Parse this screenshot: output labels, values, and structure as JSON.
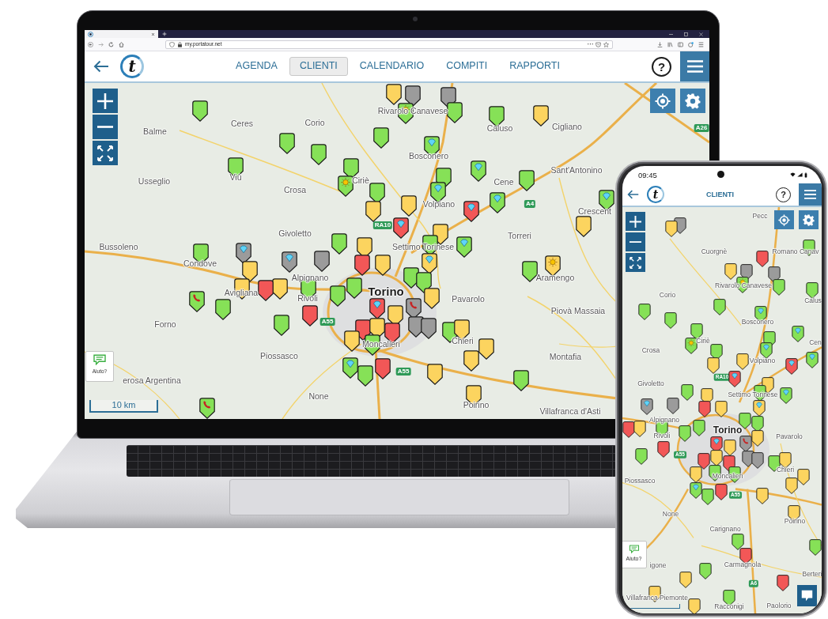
{
  "laptop": {
    "browser": {
      "url": "my.portatour.net"
    },
    "app": {
      "logo_letter": "t",
      "tabs": [
        {
          "label": "AGENDA",
          "selected": false
        },
        {
          "label": "CLIENTI",
          "selected": true
        },
        {
          "label": "CALENDARIO",
          "selected": false
        },
        {
          "label": "COMPITI",
          "selected": false
        },
        {
          "label": "RAPPORTI",
          "selected": false
        }
      ],
      "help": "?"
    },
    "map": {
      "places": [
        {
          "name": "Rivarolo Canavese",
          "kind": "town"
        },
        {
          "name": "Balme",
          "kind": "town"
        },
        {
          "name": "Ceres",
          "kind": "town"
        },
        {
          "name": "Corio",
          "kind": "town"
        },
        {
          "name": "Caluso",
          "kind": "town"
        },
        {
          "name": "Cigliano",
          "kind": "town"
        },
        {
          "name": "Bosconero",
          "kind": "town"
        },
        {
          "name": "Usseglio",
          "kind": "town"
        },
        {
          "name": "Viù",
          "kind": "town"
        },
        {
          "name": "Crosa",
          "kind": "town"
        },
        {
          "name": "Ciriè",
          "kind": "town"
        },
        {
          "name": "Cene",
          "kind": "town"
        },
        {
          "name": "Sant'Antonino",
          "kind": "town"
        },
        {
          "name": "Volpiano",
          "kind": "town"
        },
        {
          "name": "Crescent",
          "kind": "town"
        },
        {
          "name": "Givoletto",
          "kind": "town"
        },
        {
          "name": "Torreri",
          "kind": "town"
        },
        {
          "name": "Bussoleno",
          "kind": "town"
        },
        {
          "name": "Settimo Torinese",
          "kind": "town"
        },
        {
          "name": "Condove",
          "kind": "town"
        },
        {
          "name": "Alpignano",
          "kind": "town"
        },
        {
          "name": "Aramengo",
          "kind": "town"
        },
        {
          "name": "Avigliana",
          "kind": "town"
        },
        {
          "name": "Rivoli",
          "kind": "town"
        },
        {
          "name": "Torino",
          "kind": "city"
        },
        {
          "name": "Pavarolo",
          "kind": "town"
        },
        {
          "name": "Piovà Massaia",
          "kind": "town"
        },
        {
          "name": "Forno",
          "kind": "town"
        },
        {
          "name": "Moncalieri",
          "kind": "town"
        },
        {
          "name": "Chieri",
          "kind": "town"
        },
        {
          "name": "Piossasco",
          "kind": "town"
        },
        {
          "name": "Montafia",
          "kind": "town"
        },
        {
          "name": "erosa Argentina",
          "kind": "town"
        },
        {
          "name": "None",
          "kind": "town"
        },
        {
          "name": "Poirino",
          "kind": "town"
        },
        {
          "name": "Villafranca d'Asti",
          "kind": "town"
        }
      ],
      "roads": [
        "A26",
        "A4",
        "RA10",
        "A55",
        "A55"
      ],
      "markers": [
        {
          "kind": "plain",
          "color": "#fcd45f"
        },
        {
          "kind": "plain",
          "color": "#9b9b9b"
        },
        {
          "kind": "plain",
          "color": "#9b9b9b"
        },
        {
          "kind": "sun",
          "color": "#86e157"
        },
        {
          "kind": "plain",
          "color": "#86e157"
        },
        {
          "kind": "plain",
          "color": "#86e157"
        },
        {
          "kind": "plain",
          "color": "#86e157"
        },
        {
          "kind": "plain",
          "color": "#fcd45f"
        },
        {
          "kind": "plain",
          "color": "#86e157"
        },
        {
          "kind": "plain",
          "color": "#86e157"
        },
        {
          "kind": "diamond",
          "color": "#86e157"
        },
        {
          "kind": "plain",
          "color": "#86e157"
        },
        {
          "kind": "plain",
          "color": "#86e157"
        },
        {
          "kind": "plain",
          "color": "#86e157"
        },
        {
          "kind": "diamond",
          "color": "#86e157"
        },
        {
          "kind": "plain",
          "color": "#86e157"
        },
        {
          "kind": "plain",
          "color": "#86e157"
        },
        {
          "kind": "sun",
          "color": "#86e157"
        },
        {
          "kind": "diamond",
          "color": "#86e157"
        },
        {
          "kind": "plain",
          "color": "#86e157"
        },
        {
          "kind": "diamond",
          "color": "#86e157"
        },
        {
          "kind": "diamond",
          "color": "#86e157"
        },
        {
          "kind": "plain",
          "color": "#fcd45f"
        },
        {
          "kind": "plain",
          "color": "#fcd45f"
        },
        {
          "kind": "diamond",
          "color": "#f25757"
        },
        {
          "kind": "plain",
          "color": "#fcd45f"
        },
        {
          "kind": "diamond",
          "color": "#f25757"
        },
        {
          "kind": "plain",
          "color": "#fcd45f"
        },
        {
          "kind": "plain",
          "color": "#86e157"
        },
        {
          "kind": "plain",
          "color": "#86e157"
        },
        {
          "kind": "diamond",
          "color": "#86e157"
        },
        {
          "kind": "plain",
          "color": "#fcd45f"
        },
        {
          "kind": "diamond",
          "color": "#9b9b9b"
        },
        {
          "kind": "plain",
          "color": "#86e157"
        },
        {
          "kind": "diamond",
          "color": "#9b9b9b"
        },
        {
          "kind": "plain",
          "color": "#9b9b9b"
        },
        {
          "kind": "plain",
          "color": "#f25757"
        },
        {
          "kind": "plain",
          "color": "#fcd45f"
        },
        {
          "kind": "diamond",
          "color": "#fcd45f"
        },
        {
          "kind": "sun",
          "color": "#fcd45f"
        },
        {
          "kind": "plain",
          "color": "#86e157"
        },
        {
          "kind": "plain",
          "color": "#fcd45f"
        },
        {
          "kind": "plain",
          "color": "#86e157"
        },
        {
          "kind": "plain",
          "color": "#fcd45f"
        },
        {
          "kind": "plain",
          "color": "#86e157"
        },
        {
          "kind": "plain",
          "color": "#86e157"
        },
        {
          "kind": "plain",
          "color": "#fcd45f"
        },
        {
          "kind": "plain",
          "color": "#86e157"
        },
        {
          "kind": "plain",
          "color": "#f25757"
        },
        {
          "kind": "plain",
          "color": "#fcd45f"
        },
        {
          "kind": "plain",
          "color": "#86e157"
        },
        {
          "kind": "phone",
          "color": "#86e157"
        },
        {
          "kind": "diamond",
          "color": "#f25757"
        },
        {
          "kind": "phone",
          "color": "#9b9b9b"
        },
        {
          "kind": "plain",
          "color": "#86e157"
        },
        {
          "kind": "plain",
          "color": "#f25757"
        },
        {
          "kind": "plain",
          "color": "#fcd45f"
        },
        {
          "kind": "plain",
          "color": "#86e157"
        },
        {
          "kind": "plain",
          "color": "#9b9b9b"
        },
        {
          "kind": "plain",
          "color": "#9b9b9b"
        },
        {
          "kind": "plain",
          "color": "#f25757"
        },
        {
          "kind": "plain",
          "color": "#fcd45f"
        },
        {
          "kind": "plain",
          "color": "#f25757"
        },
        {
          "kind": "plain",
          "color": "#86e157"
        },
        {
          "kind": "plain",
          "color": "#fcd45f"
        },
        {
          "kind": "plain",
          "color": "#fcd45f"
        },
        {
          "kind": "plain",
          "color": "#86e157"
        },
        {
          "kind": "plain",
          "color": "#fcd45f"
        },
        {
          "kind": "plain",
          "color": "#fcd45f"
        },
        {
          "kind": "diamond",
          "color": "#86e157"
        },
        {
          "kind": "plain",
          "color": "#f25757"
        },
        {
          "kind": "plain",
          "color": "#fcd45f"
        },
        {
          "kind": "plain",
          "color": "#86e157"
        },
        {
          "kind": "plain",
          "color": "#86e157"
        },
        {
          "kind": "plain",
          "color": "#fcd45f"
        },
        {
          "kind": "phone",
          "color": "#86e157"
        }
      ],
      "help_label": "Aiuto?",
      "scale": "10 km"
    }
  },
  "phone": {
    "status": {
      "time": "09:45"
    },
    "app": {
      "logo_letter": "t",
      "title": "CLIENTI",
      "help": "?"
    },
    "map": {
      "places": [
        {
          "name": "Pecc",
          "kind": "town"
        },
        {
          "name": "Cuorgnè",
          "kind": "town"
        },
        {
          "name": "Romano Canav",
          "kind": "town"
        },
        {
          "name": "Rivarolo Canavese",
          "kind": "town"
        },
        {
          "name": "Corio",
          "kind": "town"
        },
        {
          "name": "Calus",
          "kind": "town"
        },
        {
          "name": "Bosconero",
          "kind": "town"
        },
        {
          "name": "Crosa",
          "kind": "town"
        },
        {
          "name": "Ciriè",
          "kind": "town"
        },
        {
          "name": "Cen",
          "kind": "town"
        },
        {
          "name": "Volpiano",
          "kind": "town"
        },
        {
          "name": "Givoletto",
          "kind": "town"
        },
        {
          "name": "Settimo Torinese",
          "kind": "town"
        },
        {
          "name": "Alpignano",
          "kind": "town"
        },
        {
          "name": "Rivoli",
          "kind": "town"
        },
        {
          "name": "Torino",
          "kind": "city"
        },
        {
          "name": "Pavarolo",
          "kind": "town"
        },
        {
          "name": "Piossasco",
          "kind": "town"
        },
        {
          "name": "Moncalieri",
          "kind": "town"
        },
        {
          "name": "Chieri",
          "kind": "town"
        },
        {
          "name": "None",
          "kind": "town"
        },
        {
          "name": "Carignano",
          "kind": "town"
        },
        {
          "name": "Poirino",
          "kind": "town"
        },
        {
          "name": "igone",
          "kind": "town"
        },
        {
          "name": "Carmagnola",
          "kind": "town"
        },
        {
          "name": "Berteri",
          "kind": "town"
        },
        {
          "name": "Villafranca Piemonte",
          "kind": "town"
        },
        {
          "name": "Racconigi",
          "kind": "town"
        },
        {
          "name": "Paolorio",
          "kind": "town"
        }
      ],
      "roads": [
        "RA10",
        "A55",
        "A55",
        "A6"
      ],
      "markers": [
        {
          "kind": "plain",
          "color": "#9b9b9b"
        },
        {
          "kind": "plain",
          "color": "#fcd45f"
        },
        {
          "kind": "plain",
          "color": "#86e157"
        },
        {
          "kind": "plain",
          "color": "#f25757"
        },
        {
          "kind": "plain",
          "color": "#fcd45f"
        },
        {
          "kind": "plain",
          "color": "#9b9b9b"
        },
        {
          "kind": "plain",
          "color": "#9b9b9b"
        },
        {
          "kind": "sun",
          "color": "#86e157"
        },
        {
          "kind": "plain",
          "color": "#86e157"
        },
        {
          "kind": "plain",
          "color": "#86e157"
        },
        {
          "kind": "plain",
          "color": "#86e157"
        },
        {
          "kind": "plain",
          "color": "#86e157"
        },
        {
          "kind": "diamond",
          "color": "#86e157"
        },
        {
          "kind": "plain",
          "color": "#86e157"
        },
        {
          "kind": "plain",
          "color": "#86e157"
        },
        {
          "kind": "diamond",
          "color": "#86e157"
        },
        {
          "kind": "plain",
          "color": "#86e157"
        },
        {
          "kind": "sun",
          "color": "#86e157"
        },
        {
          "kind": "diamond",
          "color": "#86e157"
        },
        {
          "kind": "plain",
          "color": "#86e157"
        },
        {
          "kind": "diamond",
          "color": "#86e157"
        },
        {
          "kind": "plain",
          "color": "#fcd45f"
        },
        {
          "kind": "plain",
          "color": "#fcd45f"
        },
        {
          "kind": "diamond",
          "color": "#f25757"
        },
        {
          "kind": "diamond",
          "color": "#f25757"
        },
        {
          "kind": "plain",
          "color": "#fcd45f"
        },
        {
          "kind": "plain",
          "color": "#86e157"
        },
        {
          "kind": "plain",
          "color": "#fcd45f"
        },
        {
          "kind": "plain",
          "color": "#86e157"
        },
        {
          "kind": "diamond",
          "color": "#86e157"
        },
        {
          "kind": "diamond",
          "color": "#9b9b9b"
        },
        {
          "kind": "plain",
          "color": "#9b9b9b"
        },
        {
          "kind": "plain",
          "color": "#f25757"
        },
        {
          "kind": "plain",
          "color": "#fcd45f"
        },
        {
          "kind": "diamond",
          "color": "#fcd45f"
        },
        {
          "kind": "plain",
          "color": "#86e157"
        },
        {
          "kind": "plain",
          "color": "#86e157"
        },
        {
          "kind": "plain",
          "color": "#f25757"
        },
        {
          "kind": "plain",
          "color": "#fcd45f"
        },
        {
          "kind": "plain",
          "color": "#86e157"
        },
        {
          "kind": "plain",
          "color": "#86e157"
        },
        {
          "kind": "plain",
          "color": "#86e157"
        },
        {
          "kind": "plain",
          "color": "#fcd45f"
        },
        {
          "kind": "diamond",
          "color": "#f25757"
        },
        {
          "kind": "phone",
          "color": "#9b9b9b"
        },
        {
          "kind": "plain",
          "color": "#fcd45f"
        },
        {
          "kind": "plain",
          "color": "#f25757"
        },
        {
          "kind": "plain",
          "color": "#86e157"
        },
        {
          "kind": "plain",
          "color": "#9b9b9b"
        },
        {
          "kind": "plain",
          "color": "#9b9b9b"
        },
        {
          "kind": "plain",
          "color": "#f25757"
        },
        {
          "kind": "plain",
          "color": "#fcd45f"
        },
        {
          "kind": "plain",
          "color": "#f25757"
        },
        {
          "kind": "plain",
          "color": "#86e157"
        },
        {
          "kind": "plain",
          "color": "#fcd45f"
        },
        {
          "kind": "plain",
          "color": "#86e157"
        },
        {
          "kind": "plain",
          "color": "#fcd45f"
        },
        {
          "kind": "plain",
          "color": "#86e157"
        },
        {
          "kind": "plain",
          "color": "#fcd45f"
        },
        {
          "kind": "plain",
          "color": "#fcd45f"
        },
        {
          "kind": "diamond",
          "color": "#86e157"
        },
        {
          "kind": "plain",
          "color": "#f25757"
        },
        {
          "kind": "plain",
          "color": "#86e157"
        },
        {
          "kind": "plain",
          "color": "#fcd45f"
        },
        {
          "kind": "plain",
          "color": "#fcd45f"
        },
        {
          "kind": "plain",
          "color": "#86e157"
        },
        {
          "kind": "plain",
          "color": "#f25757"
        },
        {
          "kind": "plain",
          "color": "#86e157"
        },
        {
          "kind": "plain",
          "color": "#86e157"
        },
        {
          "kind": "plain",
          "color": "#fcd45f"
        },
        {
          "kind": "plain",
          "color": "#f25757"
        },
        {
          "kind": "plain",
          "color": "#fcd45f"
        },
        {
          "kind": "plain",
          "color": "#86e157"
        },
        {
          "kind": "plain",
          "color": "#fcd45f"
        }
      ],
      "help_label": "Aiuto?"
    }
  }
}
